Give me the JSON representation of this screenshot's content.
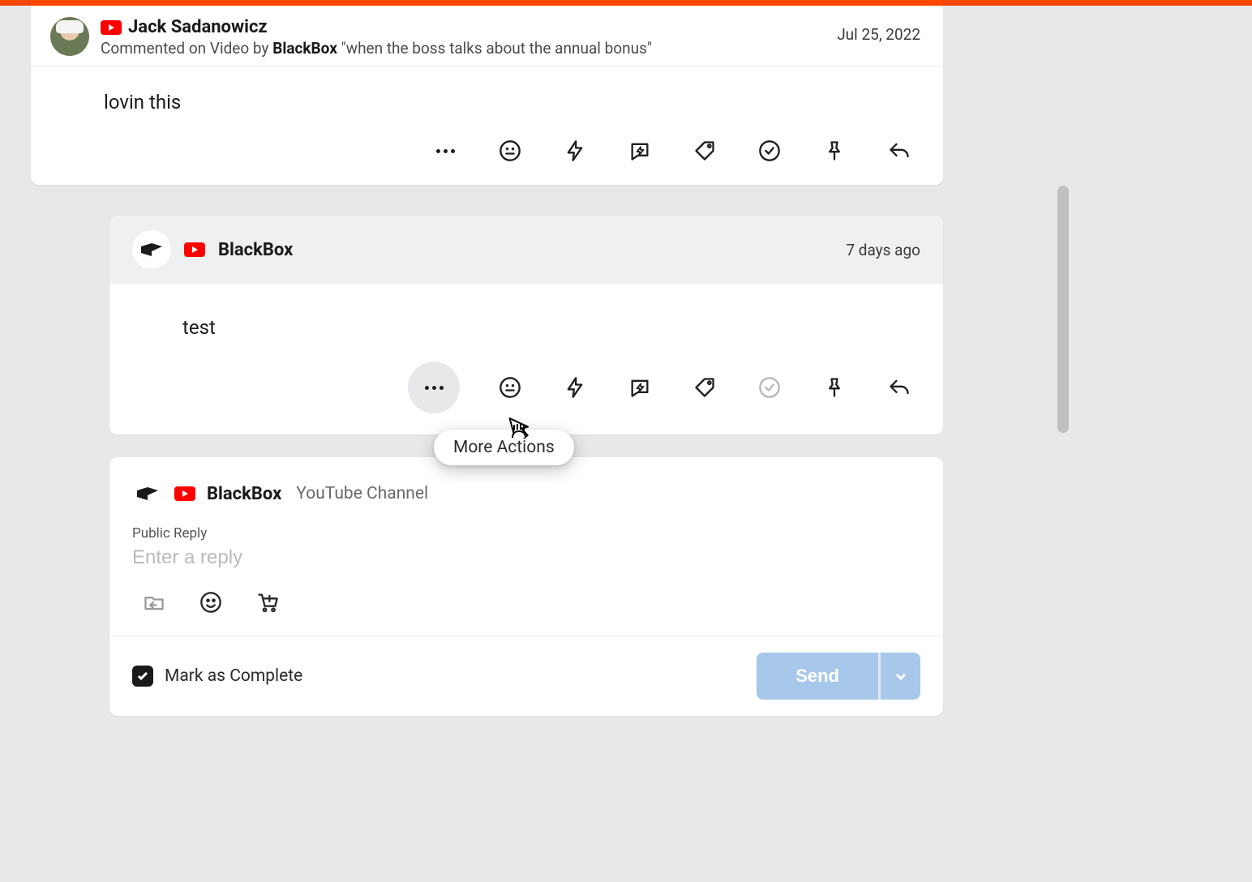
{
  "parent": {
    "author": "Jack Sadanowicz",
    "context_prefix": "Commented on Video by ",
    "context_author": "BlackBox",
    "context_title": " \"when the boss talks about the annual bonus\"",
    "date": "Jul 25, 2022",
    "body": "lovin this"
  },
  "reply": {
    "author": "BlackBox",
    "date": "7 days ago",
    "body": "test"
  },
  "tooltip": "More Actions",
  "composer": {
    "author": "BlackBox",
    "channel_type": "YouTube Channel",
    "reply_label": "Public Reply",
    "placeholder": "Enter a reply",
    "mark_complete": "Mark as Complete",
    "send": "Send"
  },
  "icons": {
    "more": "more-icon",
    "sentiment": "sentiment-icon",
    "bolt": "bolt-icon",
    "saved_reply": "saved-reply-icon",
    "tag": "tag-icon",
    "complete": "complete-icon",
    "pin": "pin-icon",
    "reply": "reply-icon",
    "emoji": "emoji-icon",
    "cart": "cart-icon",
    "saved_folder": "saved-folder-icon"
  }
}
